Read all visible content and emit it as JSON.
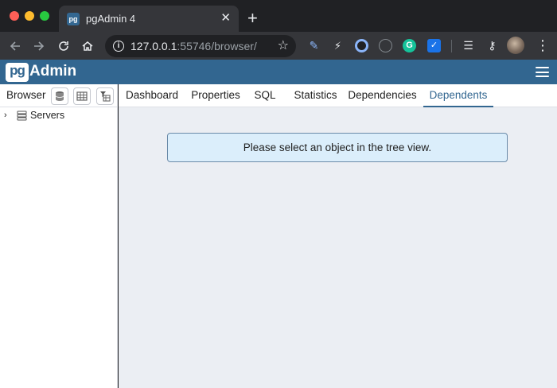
{
  "window": {
    "tab_title": "pgAdmin 4",
    "tab_favicon_text": "pg",
    "tab_close": "✕",
    "new_tab": "+"
  },
  "omnibox": {
    "url_host": "127.0.0.1",
    "url_rest": ":55746/browser/"
  },
  "extensions": [
    "pen-icon",
    "bolt-icon",
    "ring-icon",
    "block-icon",
    "grammarly-icon",
    "check-icon",
    "reading-list-icon",
    "key-icon"
  ],
  "app": {
    "logo_box": "pg",
    "logo_text": "Admin"
  },
  "browser": {
    "title": "Browser",
    "tree": [
      {
        "label": "Servers",
        "expanded": false
      }
    ]
  },
  "main": {
    "tabs": [
      {
        "label": "Dashboard",
        "active": false
      },
      {
        "label": "Properties",
        "active": false
      },
      {
        "label": "SQL",
        "active": false
      },
      {
        "label": "Statistics",
        "active": false
      },
      {
        "label": "Dependencies",
        "active": false
      },
      {
        "label": "Dependents",
        "active": true
      }
    ],
    "message": "Please select an object in the tree view."
  },
  "colors": {
    "brand": "#326690",
    "info_bg": "#dbeefb",
    "content_bg": "#ebeef3"
  }
}
